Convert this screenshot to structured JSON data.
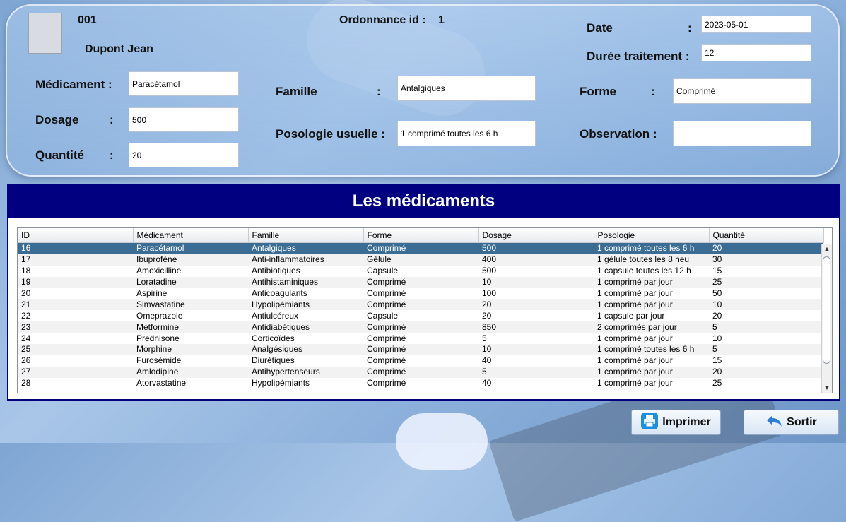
{
  "patient": {
    "id": "001",
    "name": "Dupont Jean"
  },
  "ordonnance": {
    "label": "Ordonnance id :",
    "id": "1"
  },
  "date": {
    "label": "Date",
    "colon": ":",
    "value": "2023-05-01"
  },
  "duree": {
    "label": "Durée traitement :",
    "value": "12"
  },
  "medicament": {
    "label": "Médicament :",
    "value": "Paracétamol"
  },
  "dosage": {
    "label": "Dosage",
    "colon": ":",
    "value": "500"
  },
  "quantite": {
    "label": "Quantité",
    "colon": ":",
    "value": "20"
  },
  "famille": {
    "label": "Famille",
    "colon": ":",
    "value": "Antalgiques"
  },
  "posologie": {
    "label": "Posologie usuelle :",
    "value": "1 comprimé toutes les 6 h"
  },
  "forme": {
    "label": "Forme",
    "colon": ":",
    "value": "Comprimé"
  },
  "observation": {
    "label": "Observation :",
    "value": ""
  },
  "list": {
    "title": "Les médicaments",
    "columns": [
      "ID",
      "Médicament",
      "Famille",
      "Forme",
      "Dosage",
      "Posologie",
      "Quantité"
    ],
    "selected_row": 0,
    "rows": [
      [
        "16",
        "Paracétamol",
        "Antalgiques",
        "Comprimé",
        "500",
        "1 comprimé toutes les 6 h",
        "20"
      ],
      [
        "17",
        "Ibuprofène",
        "Anti-inflammatoires",
        "Gélule",
        "400",
        "1 gélule toutes les 8 heu",
        "30"
      ],
      [
        "18",
        "Amoxicilline",
        "Antibiotiques",
        "Capsule",
        "500",
        "1 capsule toutes les 12 h",
        "15"
      ],
      [
        "19",
        "Loratadine",
        "Antihistaminiques",
        "Comprimé",
        "10",
        "1 comprimé par jour",
        "25"
      ],
      [
        "20",
        "Aspirine",
        "Anticoagulants",
        "Comprimé",
        "100",
        "1 comprimé par jour",
        "50"
      ],
      [
        "21",
        "Simvastatine",
        "Hypolipémiants",
        "Comprimé",
        "20",
        "1 comprimé par jour",
        "10"
      ],
      [
        "22",
        "Omeprazole",
        "Antiulcéreux",
        "Capsule",
        "20",
        "1 capsule par jour",
        "20"
      ],
      [
        "23",
        "Metformine",
        "Antidiabétiques",
        "Comprimé",
        "850",
        "2 comprimés par jour",
        "5"
      ],
      [
        "24",
        "Prednisone",
        "Corticoïdes",
        "Comprimé",
        "5",
        "1 comprimé par jour",
        "10"
      ],
      [
        "25",
        "Morphine",
        "Analgésiques",
        "Comprimé",
        "10",
        "1 comprimé toutes les 6 h",
        "5"
      ],
      [
        "26",
        "Furosémide",
        "Diurétiques",
        "Comprimé",
        "40",
        "1 comprimé par jour",
        "15"
      ],
      [
        "27",
        "Amlodipine",
        "Antihypertenseurs",
        "Comprimé",
        "5",
        "1 comprimé par jour",
        "20"
      ],
      [
        "28",
        "Atorvastatine",
        "Hypolipémiants",
        "Comprimé",
        "40",
        "1 comprimé par jour",
        "25"
      ]
    ]
  },
  "buttons": {
    "print_label": "Imprimer",
    "exit_label": "Sortir"
  },
  "icons": {
    "print": "printer-icon",
    "exit": "back-arrow-icon"
  },
  "colors": {
    "header_bg": "#000080",
    "selected_row": "#3a6c94"
  }
}
